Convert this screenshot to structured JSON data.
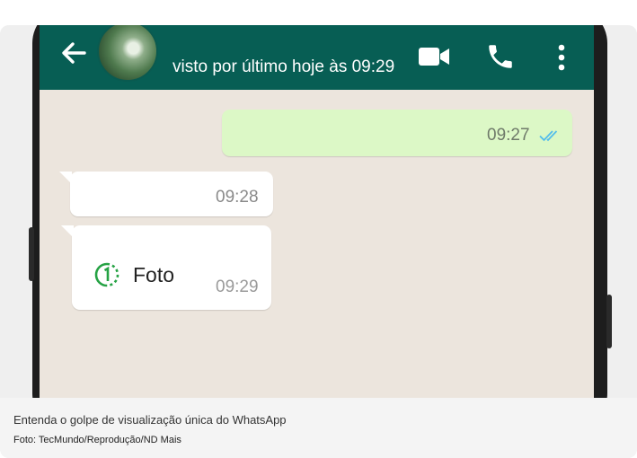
{
  "chat": {
    "contact_status": "visto por último hoje às 09:29",
    "messages": [
      {
        "direction": "outgoing",
        "time": "09:27",
        "read": true
      },
      {
        "direction": "incoming",
        "time": "09:28"
      },
      {
        "direction": "incoming",
        "type": "view-once-photo",
        "label": "Foto",
        "time": "09:29"
      }
    ],
    "header_icons": [
      "back-arrow-icon",
      "video-call-icon",
      "phone-call-icon",
      "more-options-icon"
    ],
    "colors": {
      "header": "#075e54",
      "chat_background": "#ece5dd",
      "outgoing_bubble": "#dcf8c6",
      "incoming_bubble": "#ffffff",
      "read_ticks": "#53bdeb",
      "view_once": "#25a244"
    }
  },
  "caption": {
    "text": "Entenda o golpe de visualização única do WhatsApp",
    "credit": "Foto: TecMundo/Reprodução/ND Mais"
  }
}
